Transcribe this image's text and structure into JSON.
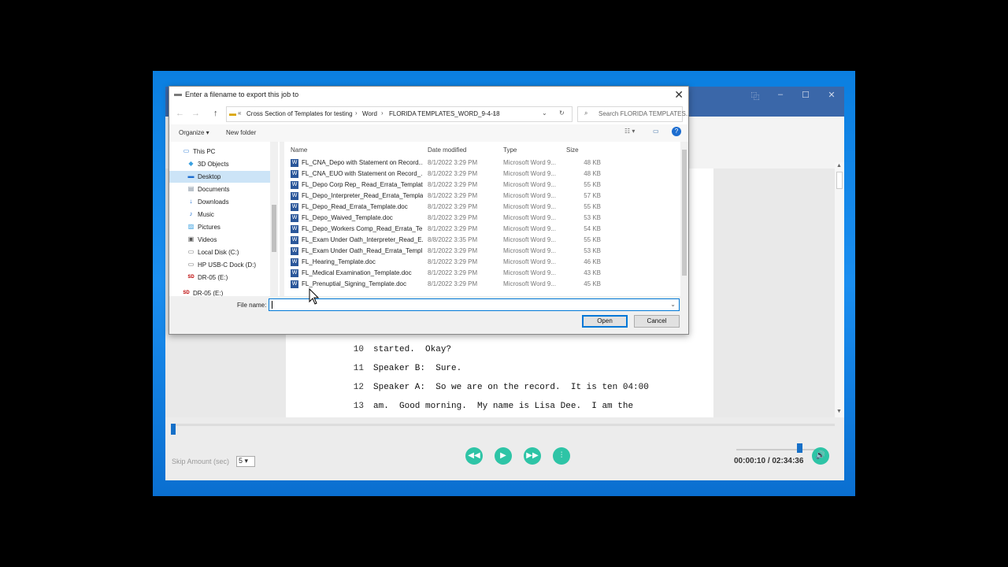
{
  "app": {
    "window_controls": [
      "⿻",
      "–",
      "☐",
      "✕"
    ],
    "document_lines": [
      {
        "num": "10",
        "text": "started.  Okay?"
      },
      {
        "num": "11",
        "text": "Speaker B:  Sure."
      },
      {
        "num": "12",
        "text": "Speaker A:  So we are on the record.  It is ten 04:00"
      },
      {
        "num": "13",
        "text": "am.  Good morning.  My name is Lisa Dee.  I am the"
      }
    ],
    "player": {
      "skip_label": "Skip Amount (sec)",
      "skip_value": "5",
      "current_time": "00:00:10",
      "separator": "/",
      "total_time": "02:34:36",
      "progress_fraction": 0.003,
      "volume_fraction": 0.9,
      "buttons": [
        "rewind",
        "play",
        "fast-forward",
        "settings",
        "volume"
      ],
      "accent_color": "#2ec4a6"
    }
  },
  "dialog": {
    "title": "Enter a filename to export this job to",
    "breadcrumb": [
      "Cross Section of Templates for testing",
      "Word",
      "FLORIDA TEMPLATES_WORD_9-4-18"
    ],
    "search_placeholder": "Search FLORIDA TEMPLATES...",
    "organize_label": "Organize ▾",
    "new_folder_label": "New folder",
    "nav_items": [
      {
        "label": "This PC",
        "icon": "computer-icon"
      },
      {
        "label": "3D Objects",
        "icon": "cube-icon"
      },
      {
        "label": "Desktop",
        "icon": "desktop-icon",
        "selected": true
      },
      {
        "label": "Documents",
        "icon": "documents-icon"
      },
      {
        "label": "Downloads",
        "icon": "download-icon"
      },
      {
        "label": "Music",
        "icon": "music-icon"
      },
      {
        "label": "Pictures",
        "icon": "pictures-icon"
      },
      {
        "label": "Videos",
        "icon": "videos-icon"
      },
      {
        "label": "Local Disk (C:)",
        "icon": "drive-icon"
      },
      {
        "label": "HP USB-C Dock (D:)",
        "icon": "usb-drive-icon"
      },
      {
        "label": "DR-05 (E:)",
        "icon": "sd-card-icon"
      },
      {
        "label": "DR-05 (E:)",
        "icon": "sd-card-icon"
      }
    ],
    "columns": {
      "name": "Name",
      "date": "Date modified",
      "type": "Type",
      "size": "Size"
    },
    "files": [
      {
        "name": "FL_CNA_Depo with Statement on Record...",
        "date": "8/1/2022 3:29 PM",
        "type": "Microsoft Word 9...",
        "size": "48 KB"
      },
      {
        "name": "FL_CNA_EUO with Statement on Record_...",
        "date": "8/1/2022 3:29 PM",
        "type": "Microsoft Word 9...",
        "size": "48 KB"
      },
      {
        "name": "FL_Depo Corp Rep_ Read_Errata_Templat...",
        "date": "8/1/2022 3:29 PM",
        "type": "Microsoft Word 9...",
        "size": "55 KB"
      },
      {
        "name": "FL_Depo_Interpreter_Read_Errata_Templa...",
        "date": "8/1/2022 3:29 PM",
        "type": "Microsoft Word 9...",
        "size": "57 KB"
      },
      {
        "name": "FL_Depo_Read_Errata_Template.doc",
        "date": "8/1/2022 3:29 PM",
        "type": "Microsoft Word 9...",
        "size": "55 KB"
      },
      {
        "name": "FL_Depo_Waived_Template.doc",
        "date": "8/1/2022 3:29 PM",
        "type": "Microsoft Word 9...",
        "size": "53 KB"
      },
      {
        "name": "FL_Depo_Workers Comp_Read_Errata_Te...",
        "date": "8/1/2022 3:29 PM",
        "type": "Microsoft Word 9...",
        "size": "54 KB"
      },
      {
        "name": "FL_Exam Under Oath_Interpreter_Read_E...",
        "date": "8/8/2022 3:35 PM",
        "type": "Microsoft Word 9...",
        "size": "55 KB"
      },
      {
        "name": "FL_Exam Under Oath_Read_Errata_Templ...",
        "date": "8/1/2022 3:29 PM",
        "type": "Microsoft Word 9...",
        "size": "53 KB"
      },
      {
        "name": "FL_Hearing_Template.doc",
        "date": "8/1/2022 3:29 PM",
        "type": "Microsoft Word 9...",
        "size": "46 KB"
      },
      {
        "name": "FL_Medical Examination_Template.doc",
        "date": "8/1/2022 3:29 PM",
        "type": "Microsoft Word 9...",
        "size": "43 KB"
      },
      {
        "name": "FL_Prenuptial_Signing_Template.doc",
        "date": "8/1/2022 3:29 PM",
        "type": "Microsoft Word 9...",
        "size": "45 KB"
      }
    ],
    "file_name_label": "File name:",
    "file_name_value": "",
    "open_label": "Open",
    "cancel_label": "Cancel"
  }
}
